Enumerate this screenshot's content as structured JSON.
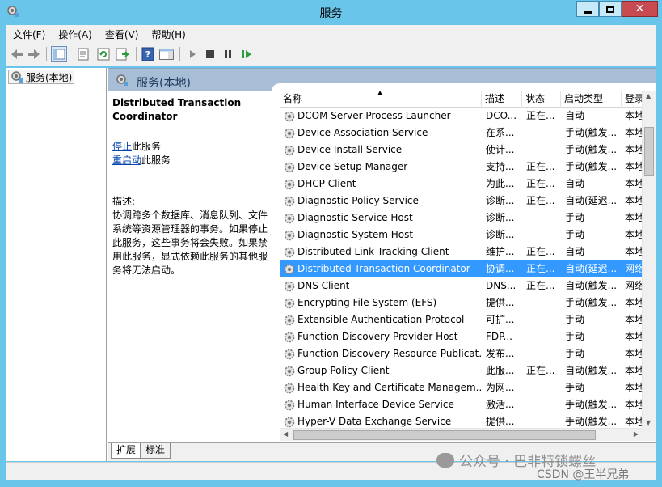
{
  "window": {
    "title": "服务",
    "close_glyph": "✕"
  },
  "menu": [
    "文件(F)",
    "操作(A)",
    "查看(V)",
    "帮助(H)"
  ],
  "toolbar": {
    "icons": [
      "back-arrow-icon",
      "forward-arrow-icon",
      "console-tree-icon",
      "properties-icon",
      "refresh-icon",
      "export-list-icon",
      "help-icon",
      "show-action-pane-icon",
      "start-service-icon",
      "stop-service-icon",
      "pause-service-icon",
      "restart-service-icon"
    ]
  },
  "tree": {
    "root_label": "服务(本地)"
  },
  "pane": {
    "title": "服务(本地)"
  },
  "description": {
    "service_title": "Distributed Transaction Coordinator",
    "stop_link": "停止",
    "stop_suffix": "此服务",
    "restart_link": "重启动",
    "restart_suffix": "此服务",
    "label": "描述:",
    "text": "协调跨多个数据库、消息队列、文件系统等资源管理器的事务。如果停止此服务，这些事务将会失败。如果禁用此服务，显式依赖此服务的其他服务将无法启动。"
  },
  "columns": {
    "name": "名称",
    "desc": "描述",
    "status": "状态",
    "startup": "启动类型",
    "logon": "登录"
  },
  "services": [
    {
      "name": "DCOM Server Process Launcher",
      "desc": "DCO...",
      "status": "正在...",
      "startup": "自动",
      "logon": "本地"
    },
    {
      "name": "Device Association Service",
      "desc": "在系...",
      "status": "",
      "startup": "手动(触发...",
      "logon": "本地"
    },
    {
      "name": "Device Install Service",
      "desc": "使计...",
      "status": "",
      "startup": "手动(触发...",
      "logon": "本地"
    },
    {
      "name": "Device Setup Manager",
      "desc": "支持...",
      "status": "正在...",
      "startup": "手动(触发...",
      "logon": "本地"
    },
    {
      "name": "DHCP Client",
      "desc": "为此...",
      "status": "正在...",
      "startup": "自动",
      "logon": "本地"
    },
    {
      "name": "Diagnostic Policy Service",
      "desc": "诊断...",
      "status": "正在...",
      "startup": "自动(延迟...",
      "logon": "本地"
    },
    {
      "name": "Diagnostic Service Host",
      "desc": "诊断...",
      "status": "",
      "startup": "手动",
      "logon": "本地"
    },
    {
      "name": "Diagnostic System Host",
      "desc": "诊断...",
      "status": "",
      "startup": "手动",
      "logon": "本地"
    },
    {
      "name": "Distributed Link Tracking Client",
      "desc": "维护...",
      "status": "正在...",
      "startup": "自动",
      "logon": "本地"
    },
    {
      "name": "Distributed Transaction Coordinator",
      "desc": "协调...",
      "status": "正在...",
      "startup": "自动(延迟...",
      "logon": "网络",
      "selected": true
    },
    {
      "name": "DNS Client",
      "desc": "DNS...",
      "status": "正在...",
      "startup": "自动(触发...",
      "logon": "网络"
    },
    {
      "name": "Encrypting File System (EFS)",
      "desc": "提供...",
      "status": "",
      "startup": "手动(触发...",
      "logon": "本地"
    },
    {
      "name": "Extensible Authentication Protocol",
      "desc": "可扩...",
      "status": "",
      "startup": "手动",
      "logon": "本地"
    },
    {
      "name": "Function Discovery Provider Host",
      "desc": "FDP...",
      "status": "",
      "startup": "手动",
      "logon": "本地"
    },
    {
      "name": "Function Discovery Resource Publicat...",
      "desc": "发布...",
      "status": "",
      "startup": "手动",
      "logon": "本地"
    },
    {
      "name": "Group Policy Client",
      "desc": "此服...",
      "status": "正在...",
      "startup": "自动(触发...",
      "logon": "本地"
    },
    {
      "name": "Health Key and Certificate Managem...",
      "desc": "为网...",
      "status": "",
      "startup": "手动",
      "logon": "本地"
    },
    {
      "name": "Human Interface Device Service",
      "desc": "激活...",
      "status": "",
      "startup": "手动(触发...",
      "logon": "本地"
    },
    {
      "name": "Hyper-V Data Exchange Service",
      "desc": "提供...",
      "status": "",
      "startup": "手动(触发...",
      "logon": "本地"
    }
  ],
  "tabs": [
    "扩展",
    "标准"
  ],
  "watermark": "公众号 · 巴非特锁螺丝",
  "csdn_mark": "CSDN @王半兄弟",
  "colors": {
    "title_bar": "#6ac5ea",
    "selection": "#3399ff",
    "pane_header": "#a8bdd6",
    "close_button": "#c74b50"
  }
}
